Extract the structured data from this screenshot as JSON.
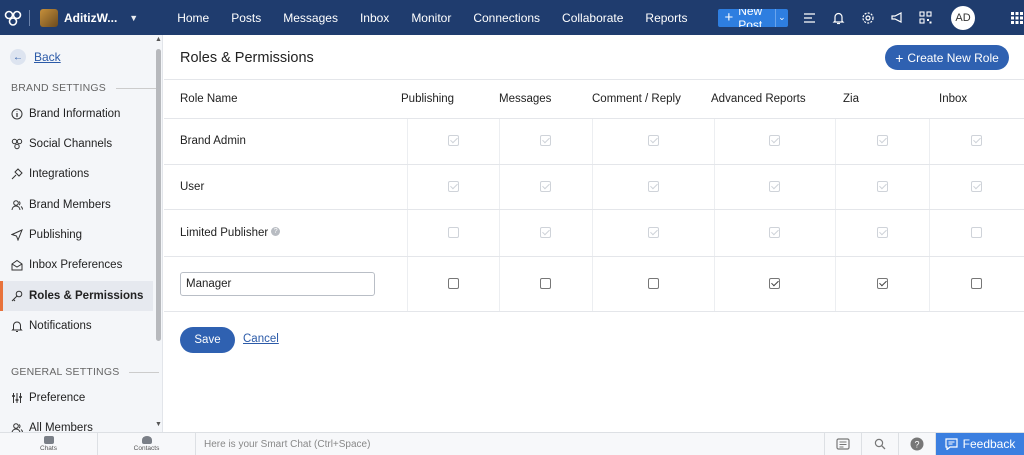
{
  "topnav": {
    "brand_name": "AditizW...",
    "items": [
      "Home",
      "Posts",
      "Messages",
      "Inbox",
      "Monitor",
      "Connections",
      "Collaborate",
      "Reports"
    ],
    "new_post": "New Post",
    "avatar_initials": "AD"
  },
  "sidebar": {
    "back": "Back",
    "brand_settings_title": "BRAND SETTINGS",
    "brand_items": [
      {
        "label": "Brand Information",
        "icon": "info-icon"
      },
      {
        "label": "Social Channels",
        "icon": "social-channels-icon"
      },
      {
        "label": "Integrations",
        "icon": "plug-icon"
      },
      {
        "label": "Brand Members",
        "icon": "users-icon"
      },
      {
        "label": "Publishing",
        "icon": "send-icon"
      },
      {
        "label": "Inbox Preferences",
        "icon": "envelope-icon"
      },
      {
        "label": "Roles & Permissions",
        "icon": "key-icon"
      },
      {
        "label": "Notifications",
        "icon": "bell-icon"
      }
    ],
    "general_settings_title": "GENERAL SETTINGS",
    "general_items": [
      {
        "label": "Preference",
        "icon": "sliders-icon"
      },
      {
        "label": "All Members",
        "icon": "users-icon"
      }
    ]
  },
  "main": {
    "title": "Roles & Permissions",
    "create_button": "Create New Role",
    "columns": [
      "Role Name",
      "Publishing",
      "Messages",
      "Comment / Reply",
      "Advanced Reports",
      "Zia",
      "Inbox"
    ],
    "rows": [
      {
        "name": "Brand Admin",
        "editable": false,
        "info": false,
        "perms": [
          true,
          true,
          true,
          true,
          true,
          true
        ],
        "disabled": true
      },
      {
        "name": "User",
        "editable": false,
        "info": false,
        "perms": [
          true,
          true,
          true,
          true,
          true,
          true
        ],
        "disabled": true
      },
      {
        "name": "Limited Publisher",
        "editable": false,
        "info": true,
        "perms": [
          false,
          true,
          true,
          true,
          true,
          false
        ],
        "disabled": true
      },
      {
        "name": "Manager",
        "editable": true,
        "info": false,
        "perms": [
          false,
          false,
          false,
          true,
          true,
          false
        ],
        "disabled": false
      }
    ],
    "save": "Save",
    "cancel": "Cancel"
  },
  "bottombar": {
    "chats": "Chats",
    "contacts": "Contacts",
    "smart_chat_placeholder": "Here is your Smart Chat (Ctrl+Space)",
    "feedback": "Feedback"
  }
}
